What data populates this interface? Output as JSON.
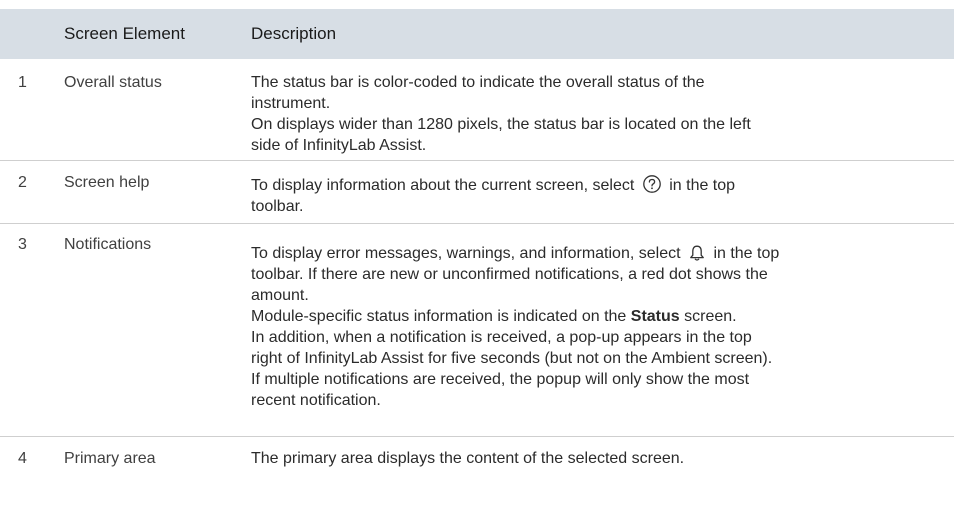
{
  "headers": {
    "col0": "",
    "col1": "Screen Element",
    "col2": "Description"
  },
  "rows": [
    {
      "num": "1",
      "element": "Overall status",
      "lines": [
        "The status bar is color-coded to indicate the overall status of the",
        "instrument.",
        "On displays wider than 1280 pixels, the status bar is located on the left",
        "side of InfinityLab Assist."
      ]
    },
    {
      "num": "2",
      "element": "Screen help",
      "pre": "To display information about the current screen, select",
      "icon": "question-circle-icon",
      "post": "in the top",
      "line2": "toolbar."
    },
    {
      "num": "3",
      "element": "Notifications",
      "pre": "To display error messages, warnings, and information, select",
      "icon": "bell-icon",
      "post": "in the top",
      "lines": [
        "toolbar. If there are new or unconfirmed notifications, a red dot shows the",
        "amount."
      ],
      "status_line_pre": "Module-specific status information is indicated on the",
      "status_line_bold": "Status",
      "status_line_post": "screen.",
      "lines_after": [
        "In addition, when a notification is received, a pop-up appears in the top",
        "right of InfinityLab Assist for five seconds (but not on the Ambient screen).",
        "If multiple notifications are received, the popup will only show the most",
        "recent notification."
      ]
    },
    {
      "num": "4",
      "element": "Primary area",
      "lines": [
        "The primary area displays the content of the selected screen."
      ]
    }
  ]
}
